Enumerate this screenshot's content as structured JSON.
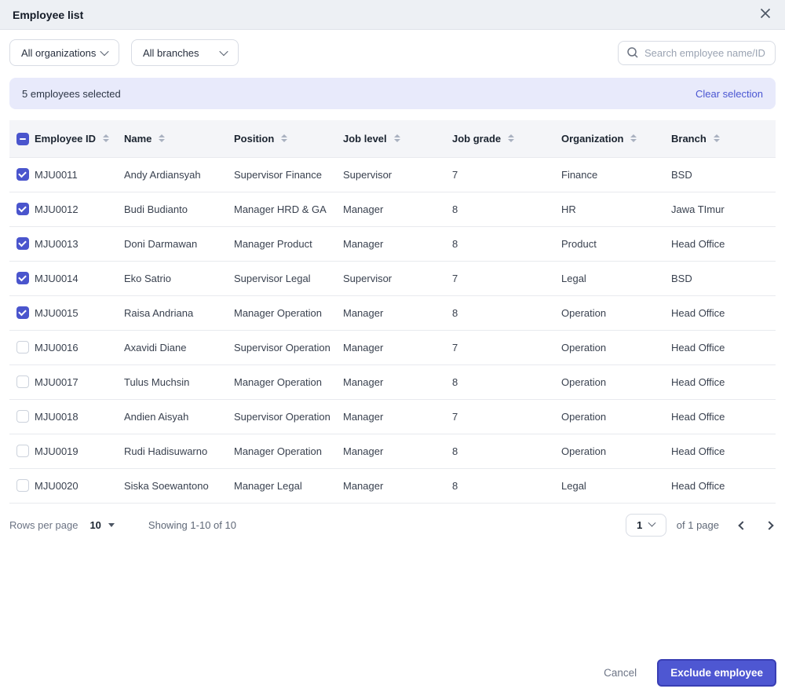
{
  "modal": {
    "title": "Employee list"
  },
  "filters": {
    "organizations_value": "All organizations",
    "branches_value": "All branches",
    "search_placeholder": "Search employee name/ID"
  },
  "selection_banner": {
    "text": "5 employees selected",
    "clear_label": "Clear selection"
  },
  "table": {
    "columns": [
      "Employee ID",
      "Name",
      "Position",
      "Job level",
      "Job grade",
      "Organization",
      "Branch"
    ],
    "header_checkbox_state": "indeterminate",
    "rows": [
      {
        "selected": true,
        "employee_id": "MJU0011",
        "name": "Andy Ardiansyah",
        "position": "Supervisor Finance",
        "job_level": "Supervisor",
        "job_grade": "7",
        "organization": "Finance",
        "branch": "BSD"
      },
      {
        "selected": true,
        "employee_id": "MJU0012",
        "name": "Budi Budianto",
        "position": "Manager HRD & GA",
        "job_level": "Manager",
        "job_grade": "8",
        "organization": "HR",
        "branch": "Jawa TImur"
      },
      {
        "selected": true,
        "employee_id": "MJU0013",
        "name": "Doni Darmawan",
        "position": "Manager Product",
        "job_level": "Manager",
        "job_grade": "8",
        "organization": "Product",
        "branch": "Head Office"
      },
      {
        "selected": true,
        "employee_id": "MJU0014",
        "name": "Eko Satrio",
        "position": "Supervisor Legal",
        "job_level": "Supervisor",
        "job_grade": "7",
        "organization": "Legal",
        "branch": "BSD"
      },
      {
        "selected": true,
        "employee_id": "MJU0015",
        "name": "Raisa Andriana",
        "position": "Manager Operation",
        "job_level": "Manager",
        "job_grade": "8",
        "organization": "Operation",
        "branch": "Head Office"
      },
      {
        "selected": false,
        "employee_id": "MJU0016",
        "name": "Axavidi Diane",
        "position": "Supervisor Operation",
        "job_level": "Manager",
        "job_grade": "7",
        "organization": "Operation",
        "branch": "Head Office"
      },
      {
        "selected": false,
        "employee_id": "MJU0017",
        "name": "Tulus Muchsin",
        "position": "Manager Operation",
        "job_level": "Manager",
        "job_grade": "8",
        "organization": "Operation",
        "branch": "Head Office"
      },
      {
        "selected": false,
        "employee_id": "MJU0018",
        "name": "Andien Aisyah",
        "position": "Supervisor Operation",
        "job_level": "Manager",
        "job_grade": "7",
        "organization": "Operation",
        "branch": "Head Office"
      },
      {
        "selected": false,
        "employee_id": "MJU0019",
        "name": "Rudi Hadisuwarno",
        "position": "Manager Operation",
        "job_level": "Manager",
        "job_grade": "8",
        "organization": "Operation",
        "branch": "Head Office"
      },
      {
        "selected": false,
        "employee_id": "MJU0020",
        "name": "Siska Soewantono",
        "position": "Manager Legal",
        "job_level": "Manager",
        "job_grade": "8",
        "organization": "Legal",
        "branch": "Head Office"
      }
    ]
  },
  "pagination": {
    "rows_per_page_label": "Rows per page",
    "rows_per_page_value": "10",
    "showing_text": "Showing 1-10 of 10",
    "page_value": "1",
    "page_count_label": "of 1 page"
  },
  "footer": {
    "cancel_label": "Cancel",
    "submit_label": "Exclude employee"
  },
  "icons": {
    "close": "close-icon",
    "search": "search-icon",
    "chevron_down": "chevron-down-icon",
    "sort": "sort-icon",
    "caret_down": "caret-down-icon",
    "chevron_left": "chevron-left-icon",
    "chevron_right": "chevron-right-icon"
  },
  "colors": {
    "accent": "#4e57d2",
    "accent_border": "#393eb4",
    "banner_bg": "#e8eafb",
    "link": "#4a56d2",
    "header_bg": "#edf0f4",
    "table_header_bg": "#f4f5f8",
    "row_border": "#e8eaee"
  }
}
